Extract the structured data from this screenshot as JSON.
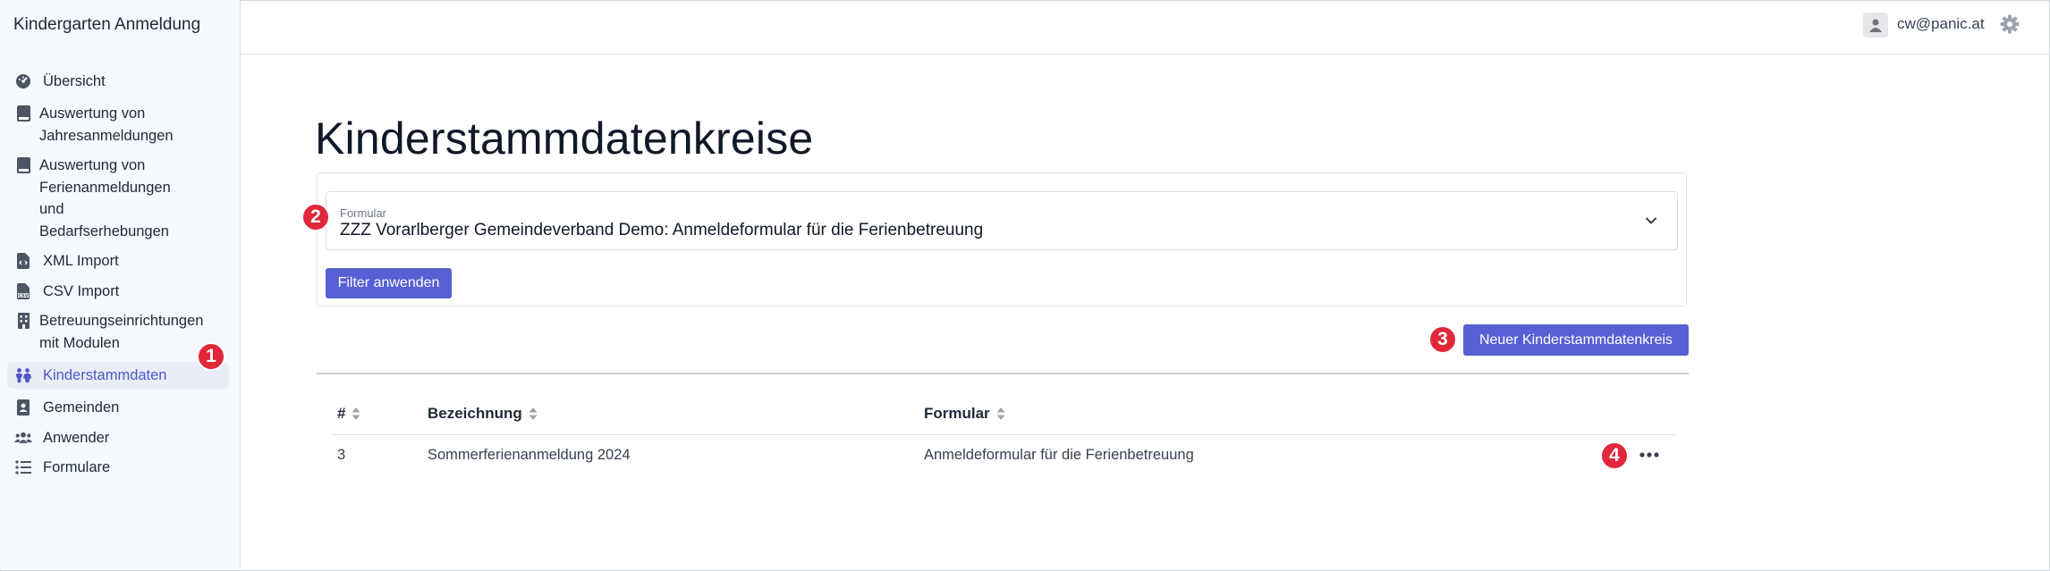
{
  "app": {
    "title": "Kindergarten Anmeldung"
  },
  "sidebar": {
    "items": [
      {
        "label": "Übersicht",
        "icon": "dashboard-icon"
      },
      {
        "label": "Auswertung von Jahresanmeldungen",
        "icon": "book-icon"
      },
      {
        "label": "Auswertung von Ferienanmeldungen und Bedarfserhebungen",
        "icon": "book-icon"
      },
      {
        "label": "XML Import",
        "icon": "xml-file-icon"
      },
      {
        "label": "CSV Import",
        "icon": "csv-file-icon"
      },
      {
        "label": "Betreuungseinrichtungen mit Modulen",
        "icon": "building-icon"
      },
      {
        "label": "Kinderstammdaten",
        "icon": "children-icon",
        "active": true
      },
      {
        "label": "Gemeinden",
        "icon": "address-book-icon"
      },
      {
        "label": "Anwender",
        "icon": "users-icon"
      },
      {
        "label": "Formulare",
        "icon": "list-icon"
      }
    ]
  },
  "header": {
    "user_email": "cw@panic.at"
  },
  "main": {
    "title": "Kinderstammdatenkreise",
    "filter": {
      "label": "Formular",
      "value": "ZZZ Vorarlberger Gemeindeverband Demo: Anmeldeformular für die Ferienbetreuung",
      "apply_label": "Filter anwenden"
    },
    "new_button_label": "Neuer Kinderstammdatenkreis",
    "table": {
      "columns": [
        "#",
        "Bezeichnung",
        "Formular"
      ],
      "rows": [
        {
          "id": "3",
          "name": "Sommerferienanmeldung 2024",
          "form": "Anmeldeformular für die Ferienbetreuung"
        }
      ]
    }
  },
  "annotations": [
    "1",
    "2",
    "3",
    "4"
  ],
  "colors": {
    "accent": "#5660d4",
    "badge": "#e0283a",
    "sidebar_bg": "#f5f8fc"
  }
}
